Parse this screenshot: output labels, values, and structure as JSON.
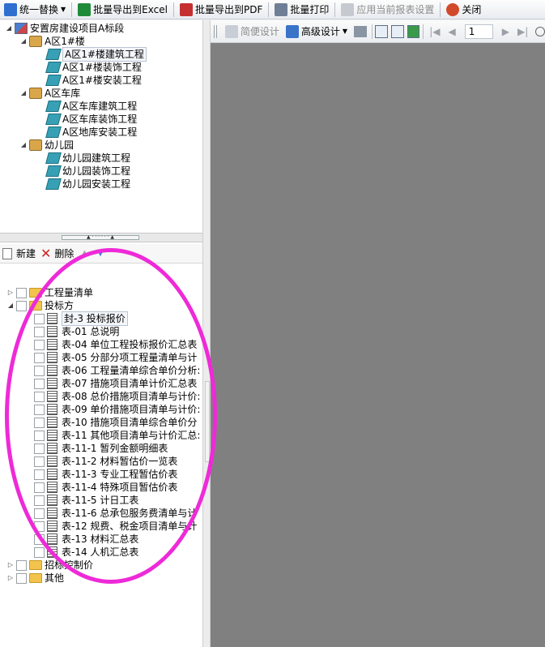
{
  "toolbar": {
    "replace_label": "统一替换",
    "export_excel_label": "批量导出到Excel",
    "export_pdf_label": "批量导出到PDF",
    "batch_print_label": "批量打印",
    "apply_settings_label": "应用当前报表设置",
    "close_label": "关闭"
  },
  "project_tree": {
    "root": "安置房建设项目A标段",
    "groups": [
      {
        "label": "A区1#楼",
        "items": [
          "A区1#楼建筑工程",
          "A区1#楼装饰工程",
          "A区1#楼安装工程"
        ]
      },
      {
        "label": "A区车库",
        "items": [
          "A区车库建筑工程",
          "A区车库装饰工程",
          "A区地库安装工程"
        ]
      },
      {
        "label": "幼儿园",
        "items": [
          "幼儿园建筑工程",
          "幼儿园装饰工程",
          "幼儿园安装工程"
        ]
      }
    ]
  },
  "tree_toolbar": {
    "new_label": "新建",
    "delete_label": "删除"
  },
  "report_tree": {
    "categories": [
      "工程量清单",
      "投标方",
      "招标控制价",
      "其他"
    ],
    "reports": [
      "封-3 投标报价",
      "表-01 总说明",
      "表-04 单位工程投标报价汇总表",
      "表-05 分部分项工程量清单与计",
      "表-06 工程量清单综合单价分析:",
      "表-07 措施项目清单计价汇总表",
      "表-08 总价措施项目清单与计价:",
      "表-09 单价措施项目清单与计价:",
      "表-10 措施项目清单综合单价分",
      "表-11 其他项目清单与计价汇总:",
      "表-11-1 暂列金额明细表",
      "表-11-2 材料暂估价一览表",
      "表-11-3 专业工程暂估价表",
      "表-11-4 特殊项目暂估价表",
      "表-11-5 计日工表",
      "表-11-6 总承包服务费清单与计",
      "表-12 规费、税金项目清单与计",
      "表-13 材料汇总表",
      "表-14 人机汇总表"
    ]
  },
  "preview_toolbar": {
    "simple_design_label": "简便设计",
    "advanced_design_label": "高级设计",
    "page_number": "1"
  },
  "colors": {
    "annotation": "#ee2ad8",
    "preview_background": "#808080"
  },
  "icons": {
    "close": "close-icon",
    "print": "printer-icon",
    "export_excel": "excel-icon",
    "export_pdf": "pdf-icon"
  }
}
